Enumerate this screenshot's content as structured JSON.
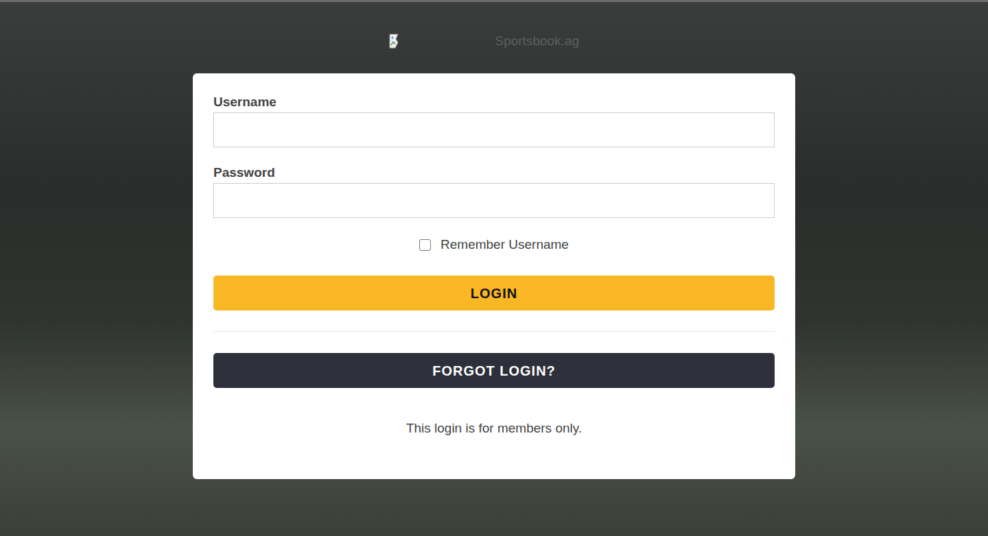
{
  "logo": {
    "alt_text": "Sportsbook.ag"
  },
  "form": {
    "fields": [
      {
        "label": "Username",
        "value": "",
        "kind": "text"
      },
      {
        "label": "Password",
        "value": "",
        "kind": "password"
      }
    ],
    "remember": {
      "label": "Remember Username",
      "checked": false
    },
    "login_button": "LOGIN",
    "forgot_button": "FORGOT LOGIN?",
    "note": "This login is for members only."
  }
}
